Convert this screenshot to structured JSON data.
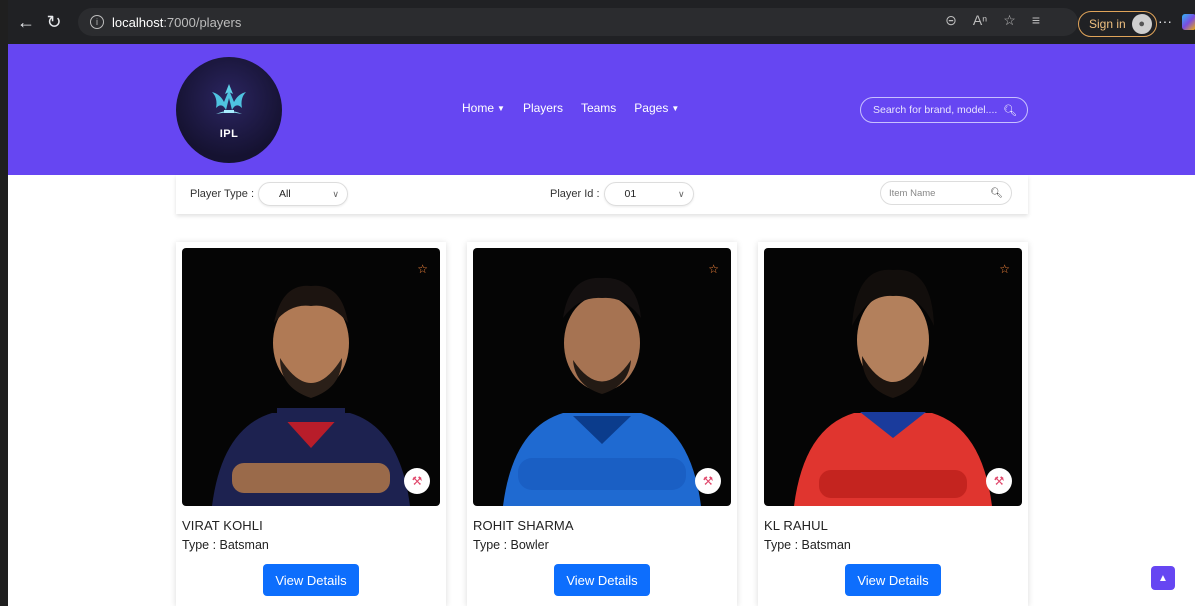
{
  "browser": {
    "url_host": "localhost",
    "url_path": ":7000/players",
    "signin_label": "Sign in",
    "more_label": "···"
  },
  "header": {
    "logo_text": "IPL",
    "nav": [
      {
        "label": "Home",
        "dropdown": true
      },
      {
        "label": "Players",
        "dropdown": false
      },
      {
        "label": "Teams",
        "dropdown": false
      },
      {
        "label": "Pages",
        "dropdown": true
      }
    ],
    "search_placeholder": "Search for brand, model...."
  },
  "filters": {
    "player_type_label": "Player Type :",
    "player_type_value": "All",
    "player_id_label": "Player Id :",
    "player_id_value": "01",
    "item_search_placeholder": "Item Name"
  },
  "players": [
    {
      "name": "VIRAT KOHLI",
      "type": "Type : Batsman",
      "button": "View Details",
      "jersey": "#1d2250",
      "accent": "#b81d2a"
    },
    {
      "name": "ROHIT SHARMA",
      "type": "Type : Bowler",
      "button": "View Details",
      "jersey": "#1f6ad1",
      "accent": "#0b3c8c"
    },
    {
      "name": "KL RAHUL",
      "type": "Type : Batsman",
      "button": "View Details",
      "jersey": "#e0352f",
      "accent": "#1a3b9c"
    }
  ],
  "colors": {
    "header_bg": "#6646f2",
    "button_bg": "#0d6efd",
    "fav_star": "#ff8a3d"
  }
}
